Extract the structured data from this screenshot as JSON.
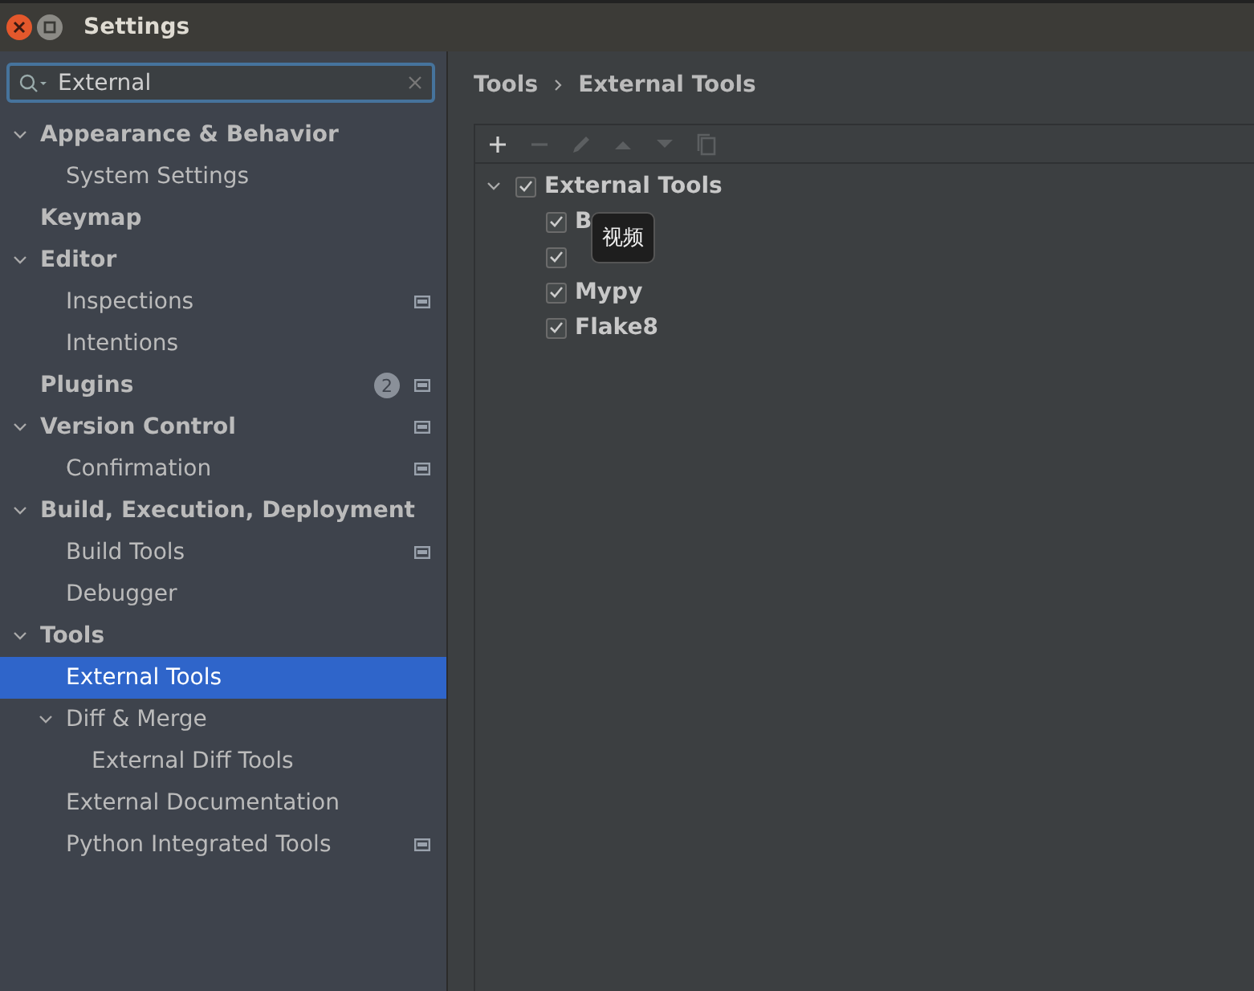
{
  "window": {
    "title": "Settings"
  },
  "search": {
    "value": "External"
  },
  "sidebar": {
    "items": [
      {
        "label": "Appearance & Behavior",
        "bold": true,
        "expanded": true,
        "children": [
          {
            "label": "System Settings"
          }
        ]
      },
      {
        "label": "Keymap",
        "bold": true
      },
      {
        "label": "Editor",
        "bold": true,
        "expanded": true,
        "children": [
          {
            "label": "Inspections",
            "project": true
          },
          {
            "label": "Intentions"
          }
        ]
      },
      {
        "label": "Plugins",
        "bold": true,
        "badge": "2",
        "project": true
      },
      {
        "label": "Version Control",
        "bold": true,
        "expanded": true,
        "project": true,
        "children": [
          {
            "label": "Confirmation",
            "project": true
          }
        ]
      },
      {
        "label": "Build, Execution, Deployment",
        "bold": true,
        "expanded": true,
        "children": [
          {
            "label": "Build Tools",
            "project": true
          },
          {
            "label": "Debugger"
          }
        ]
      },
      {
        "label": "Tools",
        "bold": true,
        "expanded": true,
        "children": [
          {
            "label": "External Tools",
            "selected": true
          },
          {
            "label": "Diff & Merge",
            "expanded": true,
            "children": [
              {
                "label": "External Diff Tools"
              }
            ]
          },
          {
            "label": "External Documentation"
          },
          {
            "label": "Python Integrated Tools",
            "project": true
          }
        ]
      }
    ]
  },
  "breadcrumb": [
    "Tools",
    "External Tools"
  ],
  "toolbar": [
    {
      "kind": "add",
      "disabled": false
    },
    {
      "kind": "remove",
      "disabled": true
    },
    {
      "kind": "edit",
      "disabled": true
    },
    {
      "kind": "up",
      "disabled": true
    },
    {
      "kind": "down",
      "disabled": true
    },
    {
      "kind": "copy",
      "disabled": true
    }
  ],
  "tools_tree": {
    "label": "External Tools",
    "checked": true,
    "expanded": true,
    "children": [
      {
        "label": "B",
        "checked": true
      },
      {
        "checked": true
      },
      {
        "label": "Mypy",
        "checked": true
      },
      {
        "label": "Flake8",
        "checked": true
      }
    ]
  },
  "tooltip": {
    "text": "视频"
  }
}
